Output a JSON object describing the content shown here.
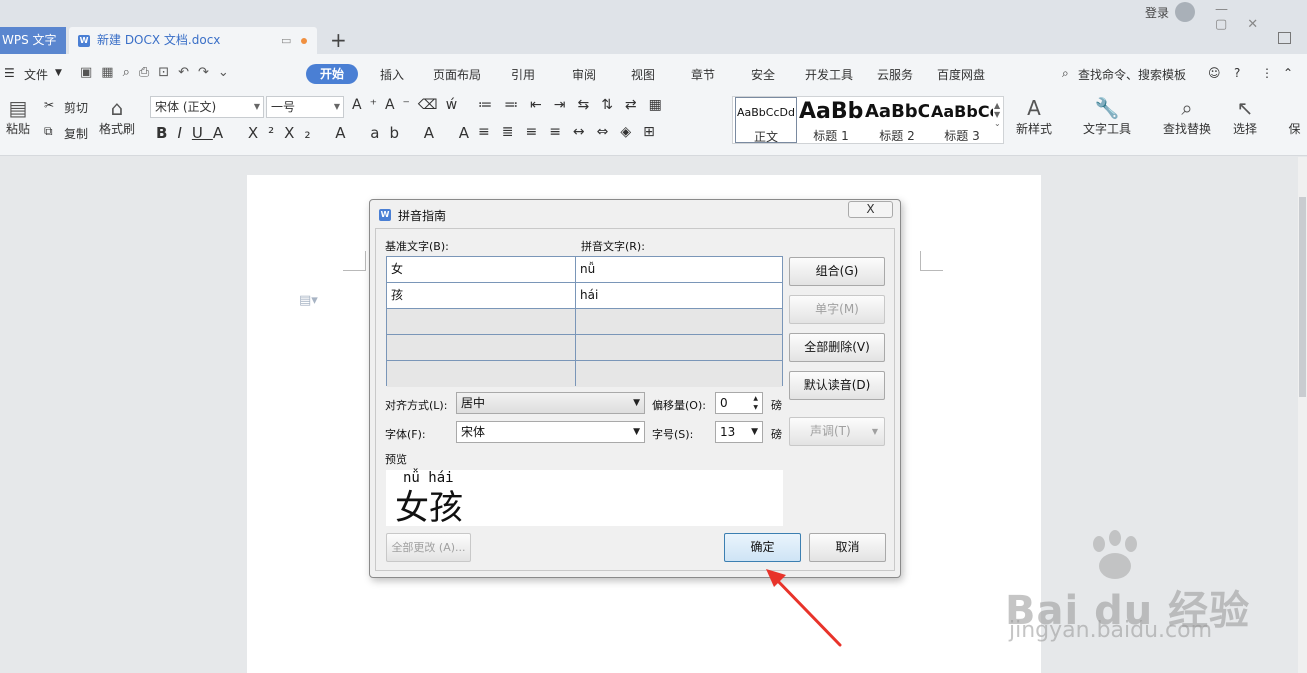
{
  "titlebar": {
    "app_tab": "WPS 文字",
    "doc_tab": "新建 DOCX 文档.docx",
    "add_tab": "+",
    "login": "登录"
  },
  "menu": {
    "file": "文件",
    "tabs": [
      "开始",
      "插入",
      "页面布局",
      "引用",
      "审阅",
      "视图",
      "章节",
      "安全",
      "开发工具",
      "云服务",
      "百度网盘"
    ],
    "search": "查找命令、搜索模板"
  },
  "ribbon": {
    "paste": "粘贴",
    "cut": "剪切",
    "copy": "复制",
    "format_painter": "格式刷",
    "font_name": "宋体 (正文)",
    "font_size": "一号",
    "styles": [
      {
        "preview": "AaBbCcDd",
        "name": "正文"
      },
      {
        "preview": "AaBb",
        "name": "标题 1"
      },
      {
        "preview": "AaBbC",
        "name": "标题 2"
      },
      {
        "preview": "AaBbCc",
        "name": "标题 3"
      }
    ],
    "new_style": "新样式",
    "text_tools": "文字工具",
    "find_replace": "查找替换",
    "select": "选择",
    "protect": "保"
  },
  "dialog": {
    "title": "拼音指南",
    "close": "X",
    "base_text_label": "基准文字(B):",
    "pinyin_text_label": "拼音文字(R):",
    "rows": [
      {
        "base": "女",
        "pinyin": "nǚ"
      },
      {
        "base": "孩",
        "pinyin": "hái"
      },
      {
        "base": "",
        "pinyin": ""
      },
      {
        "base": "",
        "pinyin": ""
      },
      {
        "base": "",
        "pinyin": ""
      }
    ],
    "btn_group": "组合(G)",
    "btn_single": "单字(M)",
    "btn_delete_all": "全部删除(V)",
    "btn_default": "默认读音(D)",
    "btn_tone": "声调(T)",
    "align_label": "对齐方式(L):",
    "align_value": "居中",
    "offset_label": "偏移量(O):",
    "offset_value": "0",
    "offset_unit": "磅",
    "font_label": "字体(F):",
    "font_value": "宋体",
    "size_label": "字号(S):",
    "size_value": "13",
    "size_unit": "磅",
    "preview_label": "预览",
    "preview_pinyin": "nǚ  hái",
    "preview_chars": "女孩",
    "btn_apply_all": "全部更改 (A)...",
    "btn_ok": "确定",
    "btn_cancel": "取消"
  },
  "watermark": {
    "brand": "Bai du 经验",
    "url": "jingyan.baidu.com"
  },
  "colors": {
    "accent": "#4a7fd4",
    "arrow": "#e8332a"
  }
}
